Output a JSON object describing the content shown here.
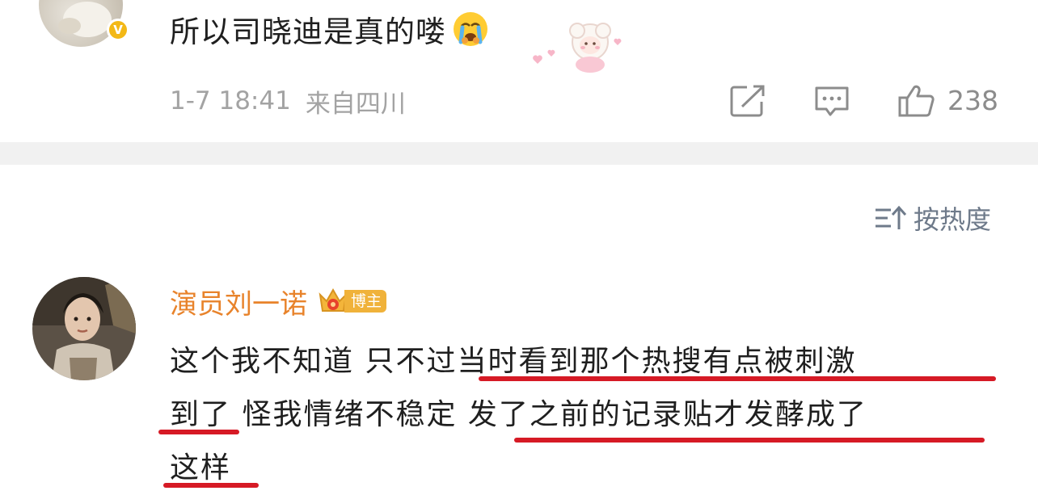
{
  "top_comment": {
    "text": "所以司晓迪是真的喽",
    "emoji": "crying-face-emoji",
    "sticker": "sheep-hearts-sticker",
    "verified_badge": "V",
    "meta": {
      "timestamp": "1-7 18:41",
      "location": "来自四川"
    },
    "actions": {
      "share_icon": "share-icon",
      "reply_icon": "comment-icon",
      "like_icon": "thumbs-up-icon",
      "like_count": "238"
    }
  },
  "sort": {
    "label": "按热度",
    "icon": "sort-icon"
  },
  "second_comment": {
    "user_name": "演员刘一诺",
    "badge_label": "博主",
    "badge_icon": "crown-icon",
    "lines": [
      "这个我不知道 只不过当时看到那个热搜有点被刺激",
      "到了 怪我情绪不稳定 发了之前的记录贴才发酵成了",
      "这样"
    ]
  },
  "colors": {
    "username": "#e8832b",
    "meta_gray": "#a3a3a3",
    "underline_red": "#d61a25",
    "sort_gray": "#6e7a8a",
    "separator": "#f1f1f1"
  }
}
